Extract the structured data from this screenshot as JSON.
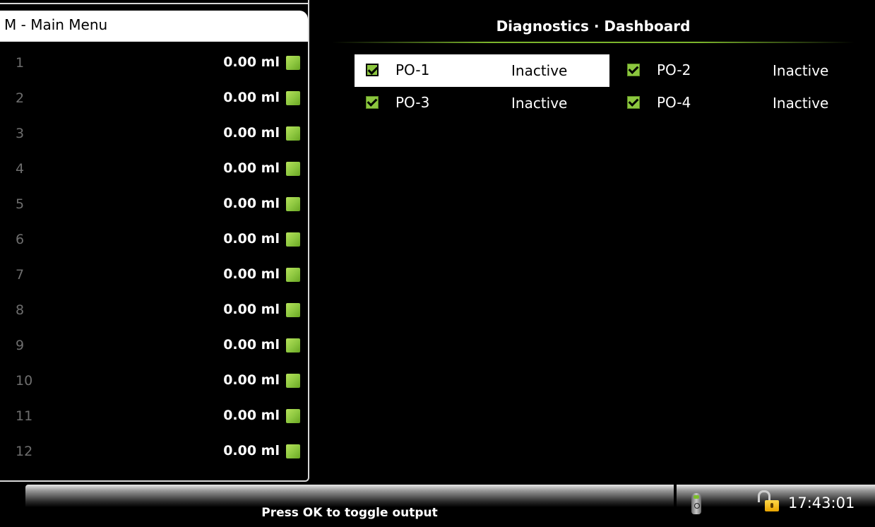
{
  "menu": {
    "title": "M - Main Menu"
  },
  "meters": [
    {
      "index": "1",
      "value": "0.00 ml"
    },
    {
      "index": "2",
      "value": "0.00 ml"
    },
    {
      "index": "3",
      "value": "0.00 ml"
    },
    {
      "index": "4",
      "value": "0.00 ml"
    },
    {
      "index": "5",
      "value": "0.00 ml"
    },
    {
      "index": "6",
      "value": "0.00 ml"
    },
    {
      "index": "7",
      "value": "0.00 ml"
    },
    {
      "index": "8",
      "value": "0.00 ml"
    },
    {
      "index": "9",
      "value": "0.00 ml"
    },
    {
      "index": "10",
      "value": "0.00 ml"
    },
    {
      "index": "11",
      "value": "0.00 ml"
    },
    {
      "index": "12",
      "value": "0.00 ml"
    }
  ],
  "dashboard": {
    "title": "Diagnostics · Dashboard",
    "outputs": [
      {
        "name": "PO-1",
        "status": "Inactive",
        "checked": true,
        "selected": true
      },
      {
        "name": "PO-2",
        "status": "Inactive",
        "checked": true,
        "selected": false
      },
      {
        "name": "PO-3",
        "status": "Inactive",
        "checked": true,
        "selected": false
      },
      {
        "name": "PO-4",
        "status": "Inactive",
        "checked": true,
        "selected": false
      }
    ]
  },
  "status_bar": {
    "hint": "Press OK to toggle output",
    "time": "17:43:01",
    "icons": [
      "remote-icon",
      "lock-icon"
    ]
  },
  "colors": {
    "accent": "#8cc63f",
    "background": "#000000",
    "panel_border": "#d8d8d8"
  }
}
